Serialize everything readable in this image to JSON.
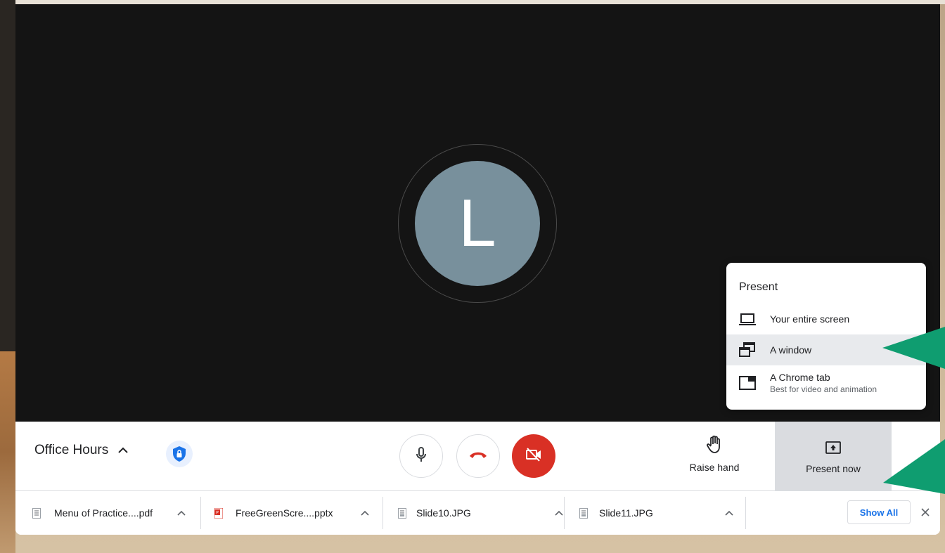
{
  "meeting": {
    "avatar_initial": "L",
    "title": "Office Hours"
  },
  "present_menu": {
    "title": "Present",
    "items": [
      {
        "label": "Your entire screen",
        "icon": "laptop-icon",
        "selected": false
      },
      {
        "label": "A window",
        "icon": "window-icon",
        "selected": true
      },
      {
        "label": "A Chrome tab",
        "sublabel": "Best for video and animation",
        "icon": "chrome-tab-icon",
        "selected": false
      }
    ]
  },
  "controls": {
    "raise_hand_label": "Raise hand",
    "present_now_label": "Present now",
    "camera_off_color": "#d93025",
    "hangup_color": "#d93025"
  },
  "download_bar": {
    "items": [
      {
        "name": "Menu of Practice....pdf",
        "icon": "document-file-icon"
      },
      {
        "name": "FreeGreenScre....pptx",
        "icon": "powerpoint-file-icon"
      },
      {
        "name": "Slide10.JPG",
        "icon": "image-file-icon"
      },
      {
        "name": "Slide11.JPG",
        "icon": "image-file-icon"
      }
    ],
    "show_all_label": "Show All"
  },
  "colors": {
    "accent_blue": "#1a73e8",
    "annotation_arrow": "#0f9d70",
    "stage_background": "#141414",
    "avatar_background": "#78909c"
  }
}
